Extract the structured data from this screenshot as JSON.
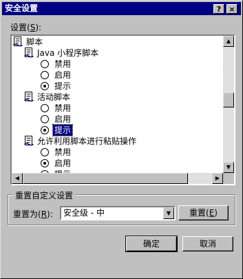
{
  "window": {
    "title": "安全设置",
    "help_label": "?",
    "close_label": "×"
  },
  "settings": {
    "label_prefix": "设置(",
    "label_key": "S",
    "label_suffix": "):",
    "tree": [
      {
        "kind": "category",
        "label": "脚本"
      },
      {
        "kind": "item",
        "label": "Java 小程序脚本"
      },
      {
        "kind": "option",
        "label": "禁用",
        "checked": false
      },
      {
        "kind": "option",
        "label": "启用",
        "checked": false
      },
      {
        "kind": "option",
        "label": "提示",
        "checked": true
      },
      {
        "kind": "item",
        "label": "活动脚本"
      },
      {
        "kind": "option",
        "label": "禁用",
        "checked": false
      },
      {
        "kind": "option",
        "label": "启用",
        "checked": false
      },
      {
        "kind": "option",
        "label": "提示",
        "checked": true,
        "selected": true
      },
      {
        "kind": "item",
        "label": "允许利用脚本进行粘贴操作"
      },
      {
        "kind": "option",
        "label": "禁用",
        "checked": false
      },
      {
        "kind": "option",
        "label": "启用",
        "checked": true
      },
      {
        "kind": "option",
        "label": "提示",
        "checked": false
      }
    ]
  },
  "reset_group": {
    "title": "重置自定义设置",
    "reset_to_prefix": "重置为(",
    "reset_to_key": "R",
    "reset_to_suffix": "):",
    "level_value": "安全级 - 中",
    "reset_button_prefix": "重置(",
    "reset_button_key": "E",
    "reset_button_suffix": ")"
  },
  "footer": {
    "ok_label": "确定",
    "cancel_label": "取消"
  },
  "icons": {
    "script": "script-icon",
    "help": "help-icon",
    "close": "close-icon",
    "dropdown": "chevron-down-icon"
  }
}
